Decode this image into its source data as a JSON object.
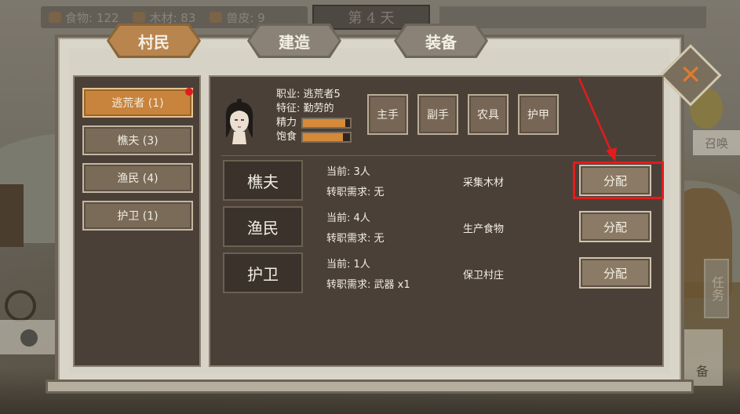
{
  "hud": {
    "resources": [
      {
        "icon": "food-icon",
        "label": "食物: 122"
      },
      {
        "icon": "wood-icon",
        "label": "木材: 83"
      },
      {
        "icon": "hide-icon",
        "label": "兽皮: 9"
      }
    ],
    "day": "第 4 天",
    "side_summon": "召唤",
    "side_task": "任务",
    "side_equip": "备"
  },
  "tabs": [
    {
      "label": "村民",
      "active": true
    },
    {
      "label": "建造",
      "active": false
    },
    {
      "label": "装备",
      "active": false
    }
  ],
  "close_icon": "close-x-icon",
  "left_list": [
    {
      "label": "逃荒者 (1)",
      "active": true,
      "badge": true
    },
    {
      "label": "樵夫 (3)",
      "active": false
    },
    {
      "label": "渔民 (4)",
      "active": false
    },
    {
      "label": "护卫 (1)",
      "active": false
    }
  ],
  "villager": {
    "job": "职业:  逃荒者5",
    "trait": "特征:  勤劳的",
    "energy_label": "精力",
    "energy": 0.9,
    "hunger_label": "饱食",
    "hunger": 0.85
  },
  "equipment_slots": [
    "主手",
    "副手",
    "农具",
    "护甲"
  ],
  "jobs": [
    {
      "name": "樵夫",
      "current": "当前: 3人",
      "requirement": "转职需求: 无",
      "desc": "采集木材",
      "button": "分配"
    },
    {
      "name": "渔民",
      "current": "当前: 4人",
      "requirement": "转职需求: 无",
      "desc": "生产食物",
      "button": "分配"
    },
    {
      "name": "护卫",
      "current": "当前: 1人",
      "requirement": "转职需求: 武器 x1",
      "desc": "保卫村庄",
      "button": "分配"
    }
  ],
  "colors": {
    "accent": "#c8833c",
    "panel_dark": "#4a4038",
    "highlight": "#e41b1b"
  }
}
